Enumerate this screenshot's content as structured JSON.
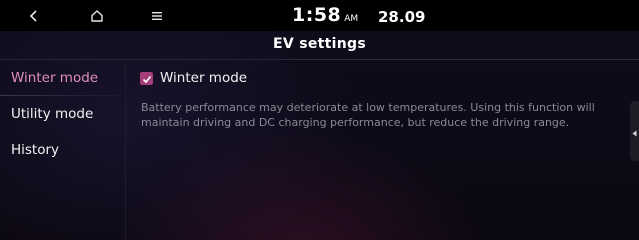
{
  "status_bar": {
    "time": "1:58",
    "ampm": "AM",
    "date": "28.09"
  },
  "icons": {
    "back": "back-chevron-icon",
    "home": "home-icon",
    "menu": "menu-icon",
    "check": "checkmark-icon",
    "handle": "left-arrow-icon"
  },
  "page": {
    "title": "EV settings"
  },
  "sidebar": {
    "items": [
      {
        "label": "Winter mode",
        "active": true
      },
      {
        "label": "Utility mode",
        "active": false
      },
      {
        "label": "History",
        "active": false
      }
    ]
  },
  "content": {
    "checkbox_label": "Winter mode",
    "checkbox_checked": true,
    "description": "Battery performance may deteriorate at low temperatures. Using this function will maintain driving and DC charging performance, but reduce the driving range."
  },
  "colors": {
    "accent": "#a23d7a",
    "active_text": "#e08dba",
    "background": "#0d0c18"
  }
}
